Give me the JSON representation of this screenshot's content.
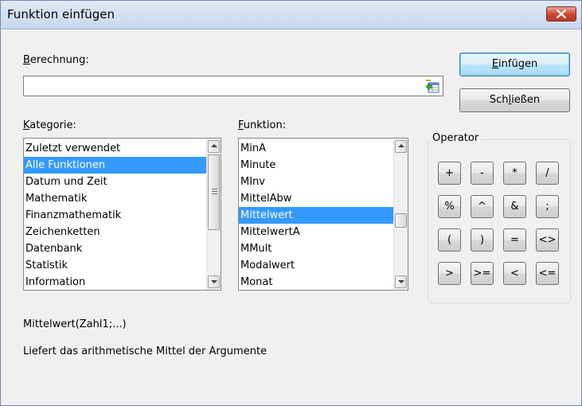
{
  "window": {
    "title": "Funktion einfügen",
    "close_icon": "close-icon"
  },
  "calculation": {
    "label_prefix": "",
    "label_hotkey": "B",
    "label_rest": "erechnung:",
    "value": "",
    "icon": "formula-field-icon"
  },
  "buttons": {
    "insert_hotkey": "E",
    "insert_rest": "infügen",
    "close_pre": "Sch",
    "close_hotkey": "l",
    "close_rest": "ießen"
  },
  "category": {
    "label_hotkey": "K",
    "label_rest": "ategorie:",
    "items": [
      "Zuletzt verwendet",
      "Alle Funktionen",
      "Datum und Zeit",
      "Mathematik",
      "Finanzmathematik",
      "Zeichenketten",
      "Datenbank",
      "Statistik",
      "Information"
    ],
    "selected_index": 1
  },
  "function": {
    "label_hotkey": "F",
    "label_rest": "unktion:",
    "items": [
      "MinA",
      "Minute",
      "MInv",
      "MittelAbw",
      "Mittelwert",
      "MittelwertA",
      "MMult",
      "Modalwert",
      "Monat"
    ],
    "selected_index": 4
  },
  "operator": {
    "label": "Operator",
    "rows": [
      [
        "+",
        "-",
        "*",
        "/"
      ],
      [
        "%",
        "^",
        "&",
        ";"
      ],
      [
        "(",
        ")",
        "=",
        "<>"
      ],
      [
        ">",
        ">=",
        "<",
        "<="
      ]
    ]
  },
  "info": {
    "syntax": "Mittelwert(Zahl1;...)",
    "description": "Liefert das arithmetische Mittel der Argumente"
  },
  "colors": {
    "selection": "#3399ff",
    "dialog_bg": "#f0f0f0",
    "close_button": "#c8452e"
  }
}
